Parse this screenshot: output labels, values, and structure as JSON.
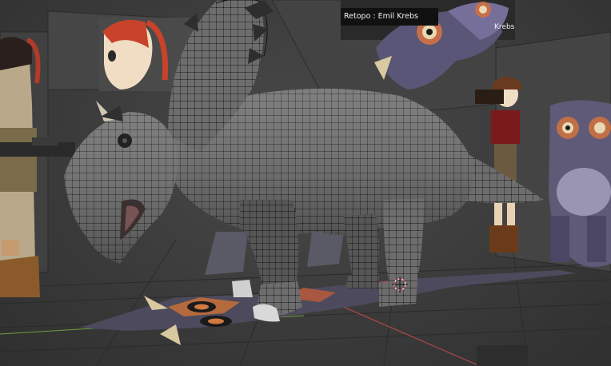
{
  "viewport": {
    "reference_label": "Retopo : Emil Krebs",
    "reference_label_2": "Krebs"
  },
  "colors": {
    "background": "#3a3a3a",
    "mesh": "#6b6b6b",
    "wire": "#111111",
    "vertex_selected": "#ff9a3a",
    "axis_x": "#b04848",
    "axis_y": "#6f9f3a"
  }
}
